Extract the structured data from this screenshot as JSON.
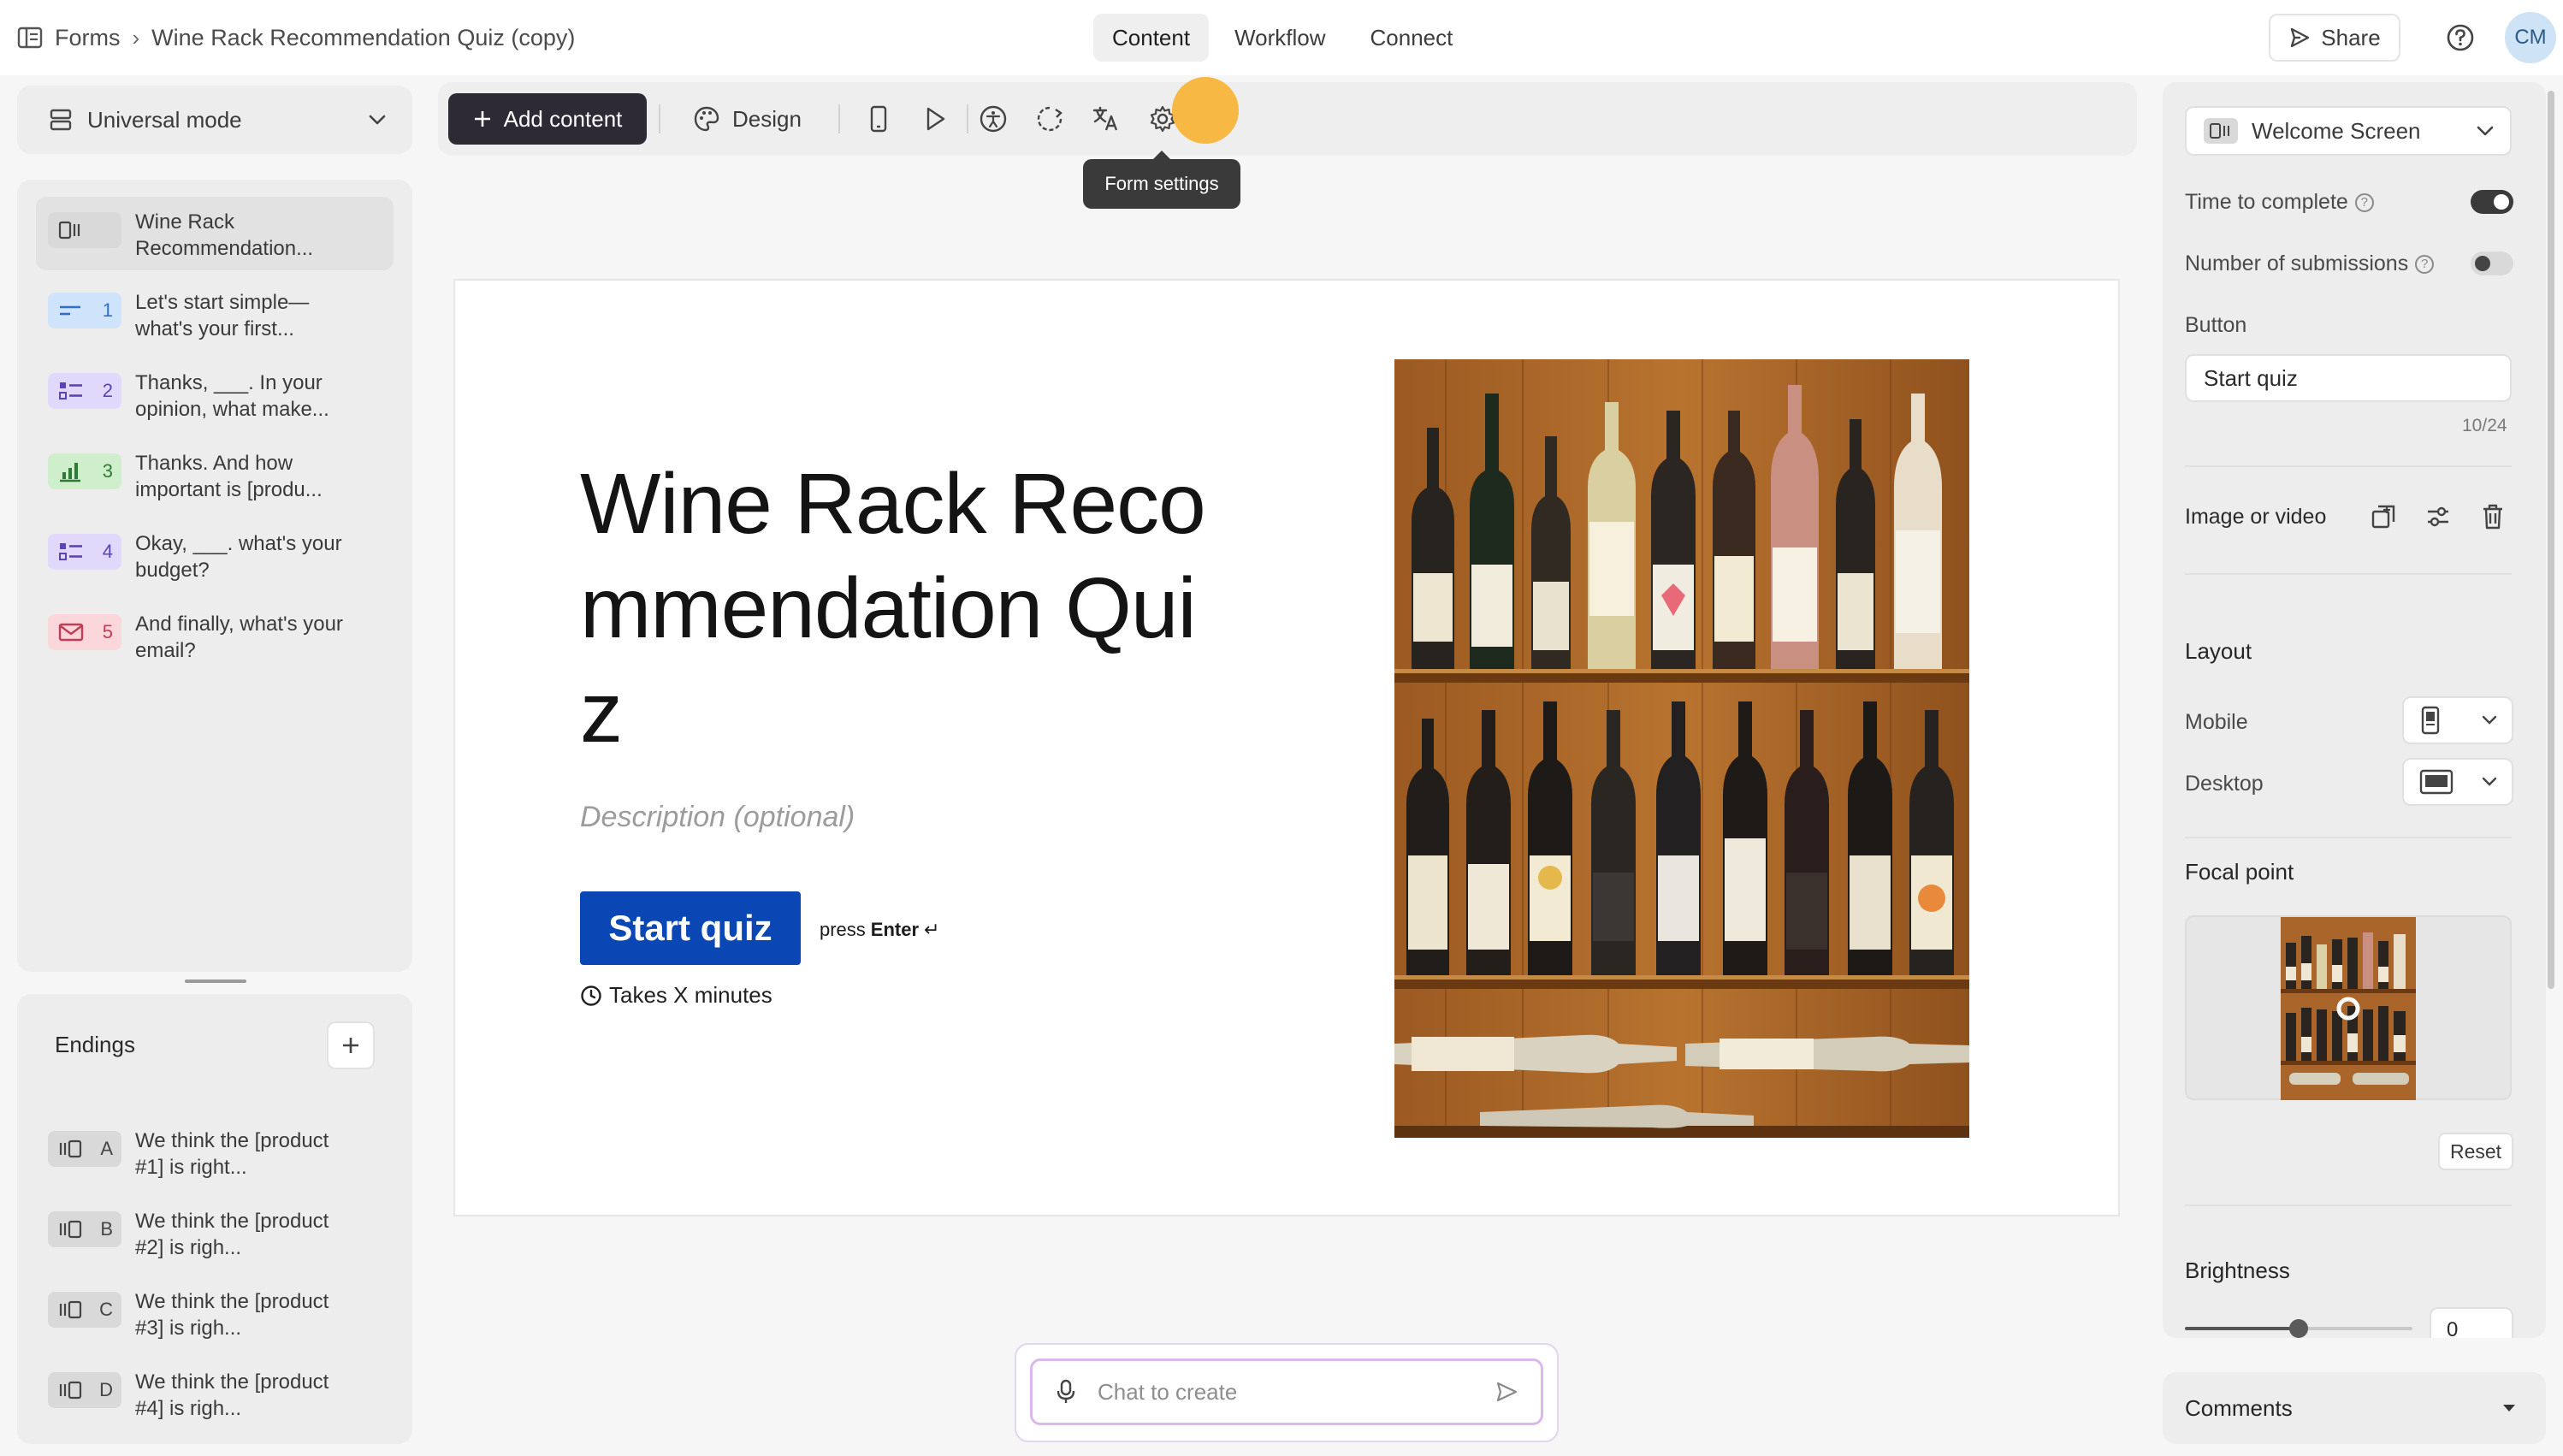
{
  "header": {
    "breadcrumb_root": "Forms",
    "breadcrumb_current": "Wine Rack Recommendation Quiz (copy)",
    "tabs": [
      {
        "label": "Content",
        "active": true
      },
      {
        "label": "Workflow",
        "active": false
      },
      {
        "label": "Connect",
        "active": false
      }
    ],
    "share_label": "Share",
    "avatar_initials": "CM"
  },
  "left": {
    "mode_label": "Universal mode",
    "questions": [
      {
        "num": "",
        "text": "Wine Rack Recommendation...",
        "icon": "welcome-screen-icon",
        "color": "#d8d8d8",
        "ink": "#444444"
      },
      {
        "num": "1",
        "text": "Let's start simple—what's your first...",
        "icon": "short-text-icon",
        "color": "#cfe3fb",
        "ink": "#2f6fc4"
      },
      {
        "num": "2",
        "text": "Thanks, ___. In your opinion, what make...",
        "icon": "multiple-choice-icon",
        "color": "#e1d9fb",
        "ink": "#5b43b8"
      },
      {
        "num": "3",
        "text": "Thanks. And how important is [produ...",
        "icon": "rating-chart-icon",
        "color": "#cfeecb",
        "ink": "#2f7a34"
      },
      {
        "num": "4",
        "text": "Okay, ___. what's your budget?",
        "icon": "multiple-choice-icon",
        "color": "#e1d9fb",
        "ink": "#5b43b8"
      },
      {
        "num": "5",
        "text": "And finally, what's your email?",
        "icon": "email-icon",
        "color": "#fbd7dc",
        "ink": "#c43b54"
      }
    ],
    "endings_title": "Endings",
    "endings": [
      {
        "letter": "A",
        "text": "We think the [product #1] is right..."
      },
      {
        "letter": "B",
        "text": "We think the [product #2] is righ..."
      },
      {
        "letter": "C",
        "text": "We think the [product #3] is righ..."
      },
      {
        "letter": "D",
        "text": "We think the [product #4] is righ..."
      }
    ]
  },
  "toolbar": {
    "add_content_label": "Add content",
    "design_label": "Design",
    "tooltip": "Form settings"
  },
  "canvas": {
    "title": "Wine Rack Recommendation Quiz",
    "description_placeholder": "Description (optional)",
    "button_label": "Start quiz",
    "press_label": "press",
    "enter_label": "Enter",
    "enter_symbol": "↵",
    "time_note": "Takes X minutes"
  },
  "chat": {
    "placeholder": "Chat to create"
  },
  "right": {
    "screen_select": "Welcome Screen",
    "time_to_complete_label": "Time to complete",
    "time_to_complete_on": true,
    "submissions_label": "Number of submissions",
    "submissions_on": false,
    "button_section": "Button",
    "button_value": "Start quiz",
    "char_count": "10/24",
    "image_label": "Image or video",
    "layout_heading": "Layout",
    "mobile_label": "Mobile",
    "desktop_label": "Desktop",
    "focal_heading": "Focal point",
    "reset_label": "Reset",
    "brightness_heading": "Brightness",
    "brightness_value": "0",
    "brightness_slider_fraction": 0.5,
    "comments_label": "Comments"
  },
  "colors": {
    "accent_button": "#0b46b5",
    "dark_button": "#2e2a35",
    "cursor": "#f8b43a",
    "toggle_on": "#3a3a3a"
  }
}
